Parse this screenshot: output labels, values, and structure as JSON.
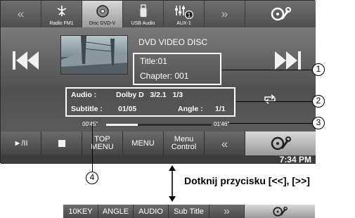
{
  "sources": [
    {
      "label": "Radio FM1",
      "icon": "antenna-icon"
    },
    {
      "label": "Disc DVD-V",
      "icon": "disc-icon"
    },
    {
      "label": "USB Audio",
      "icon": "usb-icon"
    },
    {
      "label": "AUX-1",
      "icon": "equalizer-icon",
      "badge": "1"
    }
  ],
  "nav": {
    "prev": "«",
    "next": "»"
  },
  "disc": {
    "heading": "DVD VIDEO DISC",
    "title": "Title:01",
    "chapter": "Chapter: 001"
  },
  "audio": {
    "label": "Audio :",
    "value": "Dolby D   3/2.1   1/3"
  },
  "subtitle": {
    "label": "Subtitle :",
    "value": "01/05"
  },
  "angle": {
    "label": "Angle :",
    "value": "1/1"
  },
  "progress": {
    "elapsed": "00'45\"",
    "remaining": "01'46\"",
    "fraction": 0.3
  },
  "controls": {
    "play_pause": "►/II",
    "top_menu_1": "TOP",
    "top_menu_2": "MENU",
    "menu": "MENU",
    "menu_control_1": "Menu",
    "menu_control_2": "Control",
    "back": "«"
  },
  "clock": "7:34 PM",
  "callouts": [
    "1",
    "2",
    "3",
    "4"
  ],
  "hint": "Dotknij przycisku [<<], [>>]",
  "alt_bar": [
    "10KEY",
    "ANGLE",
    "AUDIO",
    "Sub Title",
    "»"
  ],
  "colors": {
    "accent": "#ffffff",
    "panel": "#5e5e5e"
  }
}
